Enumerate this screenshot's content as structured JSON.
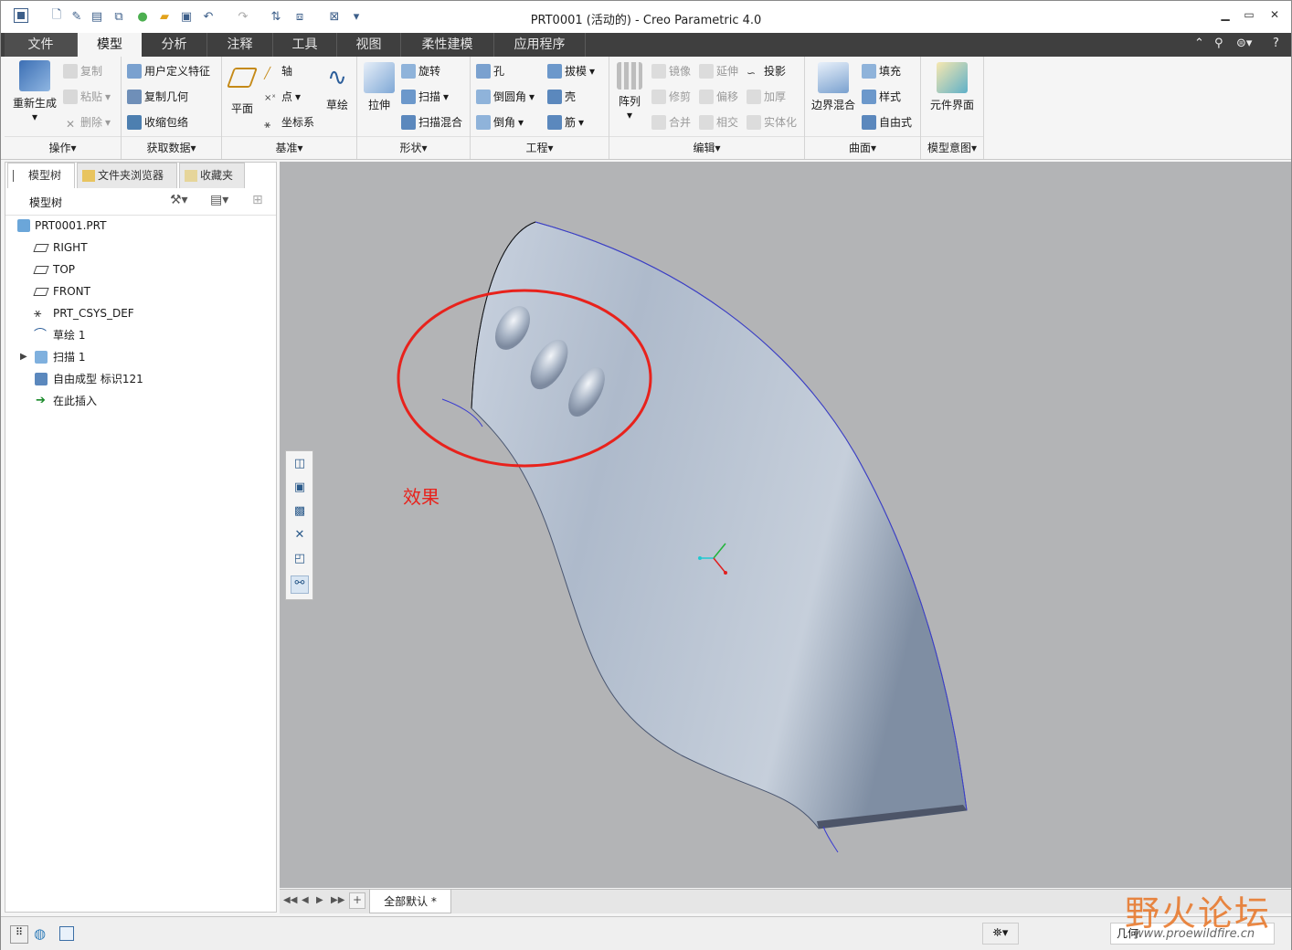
{
  "app_title": "PRT0001 (活动的) - Creo Parametric 4.0",
  "tabs": [
    "文件",
    "模型",
    "分析",
    "注释",
    "工具",
    "视图",
    "柔性建模",
    "应用程序"
  ],
  "ribbon": {
    "operations": {
      "label": "操作",
      "regenerate": "重新生成",
      "copy": "复制",
      "paste": "粘贴",
      "delete": "删除"
    },
    "get_data": {
      "label": "获取数据",
      "udf": "用户定义特征",
      "copy_geom": "复制几何",
      "shrinkwrap": "收缩包络"
    },
    "datum": {
      "label": "基准",
      "plane": "平面",
      "axis": "轴",
      "point": "点",
      "csys": "坐标系",
      "sketch": "草绘"
    },
    "shapes": {
      "label": "形状",
      "extrude": "拉伸",
      "revolve": "旋转",
      "sweep": "扫描",
      "swept_blend": "扫描混合"
    },
    "engineering": {
      "label": "工程",
      "hole": "孔",
      "round": "倒圆角",
      "chamfer": "倒角",
      "draft": "拔模",
      "shell": "壳",
      "rib": "筋"
    },
    "editing": {
      "label": "编辑",
      "pattern": "阵列",
      "mirror": "镜像",
      "trim": "修剪",
      "merge": "合并",
      "extend": "延伸",
      "offset": "偏移",
      "intersect": "相交",
      "project": "投影",
      "thicken": "加厚",
      "solidify": "实体化"
    },
    "surfaces": {
      "label": "曲面",
      "boundary_blend": "边界混合",
      "fill": "填充",
      "style": "样式",
      "freestyle": "自由式"
    },
    "model_intent": {
      "label": "模型意图",
      "component_interface": "元件界面"
    }
  },
  "panel_tabs": [
    "模型树",
    "文件夹浏览器",
    "收藏夹"
  ],
  "model_tree": {
    "header": "模型树",
    "items": [
      "PRT0001.PRT",
      "RIGHT",
      "TOP",
      "FRONT",
      "PRT_CSYS_DEF",
      "草绘 1",
      "扫描 1",
      "自由成型 标识121",
      "在此插入"
    ]
  },
  "annotation_text": "效果",
  "bottom_tab": "全部默认 *",
  "status": {
    "filter": "几何"
  },
  "watermark": {
    "text": "野火论坛",
    "url": "www.proewildfire.cn"
  },
  "colors": {
    "tab_bar": "#3f3f3f",
    "viewport": "#b3b4b6",
    "annotation": "#e8221c",
    "model": "#aebacb"
  }
}
